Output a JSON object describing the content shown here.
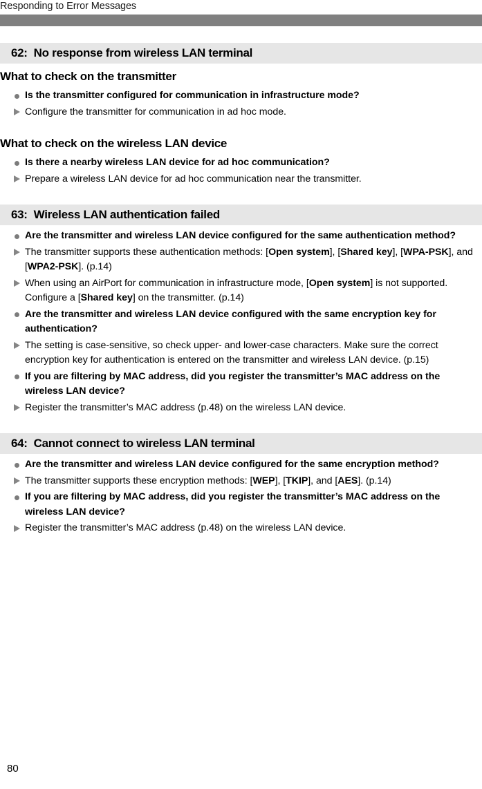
{
  "header": {
    "running_title": "Responding to Error Messages",
    "rule_color": "#808080"
  },
  "footer": {
    "page_number": "80"
  },
  "colors": {
    "banner_background": "#e6e6e6",
    "bullet_marker": "#7c7c7c",
    "arrow_marker": "#868686",
    "text": "#000000"
  },
  "sections": [
    {
      "number": "62:",
      "title": "No response from wireless LAN terminal",
      "subsections": [
        {
          "heading": "What to check on the transmitter",
          "rows": [
            {
              "marker": "dot",
              "text": "Is the transmitter configured for communication in infrastructure mode?"
            },
            {
              "marker": "tri",
              "text": "Configure the transmitter for communication in ad hoc mode."
            }
          ]
        },
        {
          "heading": "What to check on the wireless LAN device",
          "rows": [
            {
              "marker": "dot",
              "text": "Is there a nearby wireless LAN device for ad hoc communication?"
            },
            {
              "marker": "tri",
              "text": "Prepare a wireless LAN device for ad hoc communication near the transmitter."
            }
          ]
        }
      ]
    },
    {
      "number": "63:",
      "title": "Wireless LAN authentication failed",
      "subsections": [
        {
          "heading": "",
          "rows": [
            {
              "marker": "dot",
              "html": "Are the transmitter and wireless LAN device configured for the same authentication method?"
            },
            {
              "marker": "tri",
              "html": "The transmitter supports these authentication methods: [<b>Open system</b>], [<b>Shared key</b>], [<b>WPA-PSK</b>], and [<b>WPA2-PSK</b>]. (p.14)"
            },
            {
              "marker": "tri",
              "html": "When using an AirPort for communication in infrastructure mode, [<b>Open system</b>] is not supported. Configure a [<b>Shared key</b>] on the transmitter. (p.14)"
            },
            {
              "marker": "dot",
              "html": "Are the transmitter and wireless LAN device configured with the same encryption key for authentication?"
            },
            {
              "marker": "tri",
              "html": "The setting is case-sensitive, so check upper- and lower-case characters. Make sure the correct encryption key for authentication is entered on the transmitter and wireless LAN device. (p.15)"
            },
            {
              "marker": "dot",
              "html": "If you are filtering by MAC address, did you register the transmitter&rsquo;s MAC address on the wireless LAN device?"
            },
            {
              "marker": "tri",
              "html": "Register the transmitter&rsquo;s MAC address (p.48) on the wireless LAN device."
            }
          ]
        }
      ]
    },
    {
      "number": "64:",
      "title": "Cannot connect to wireless LAN terminal",
      "subsections": [
        {
          "heading": "",
          "rows": [
            {
              "marker": "dot",
              "html": "Are the transmitter and wireless LAN device configured for the same encryption method?"
            },
            {
              "marker": "tri",
              "html": "The transmitter supports these encryption methods: [<b>WEP</b>], [<b>TKIP</b>], and [<b>AES</b>]. (p.14)"
            },
            {
              "marker": "dot",
              "html": "If you are filtering by MAC address, did you register the transmitter&rsquo;s MAC address on the wireless LAN device?"
            },
            {
              "marker": "tri",
              "html": "Register the transmitter&rsquo;s MAC address (p.48) on the wireless LAN device."
            }
          ]
        }
      ]
    }
  ]
}
